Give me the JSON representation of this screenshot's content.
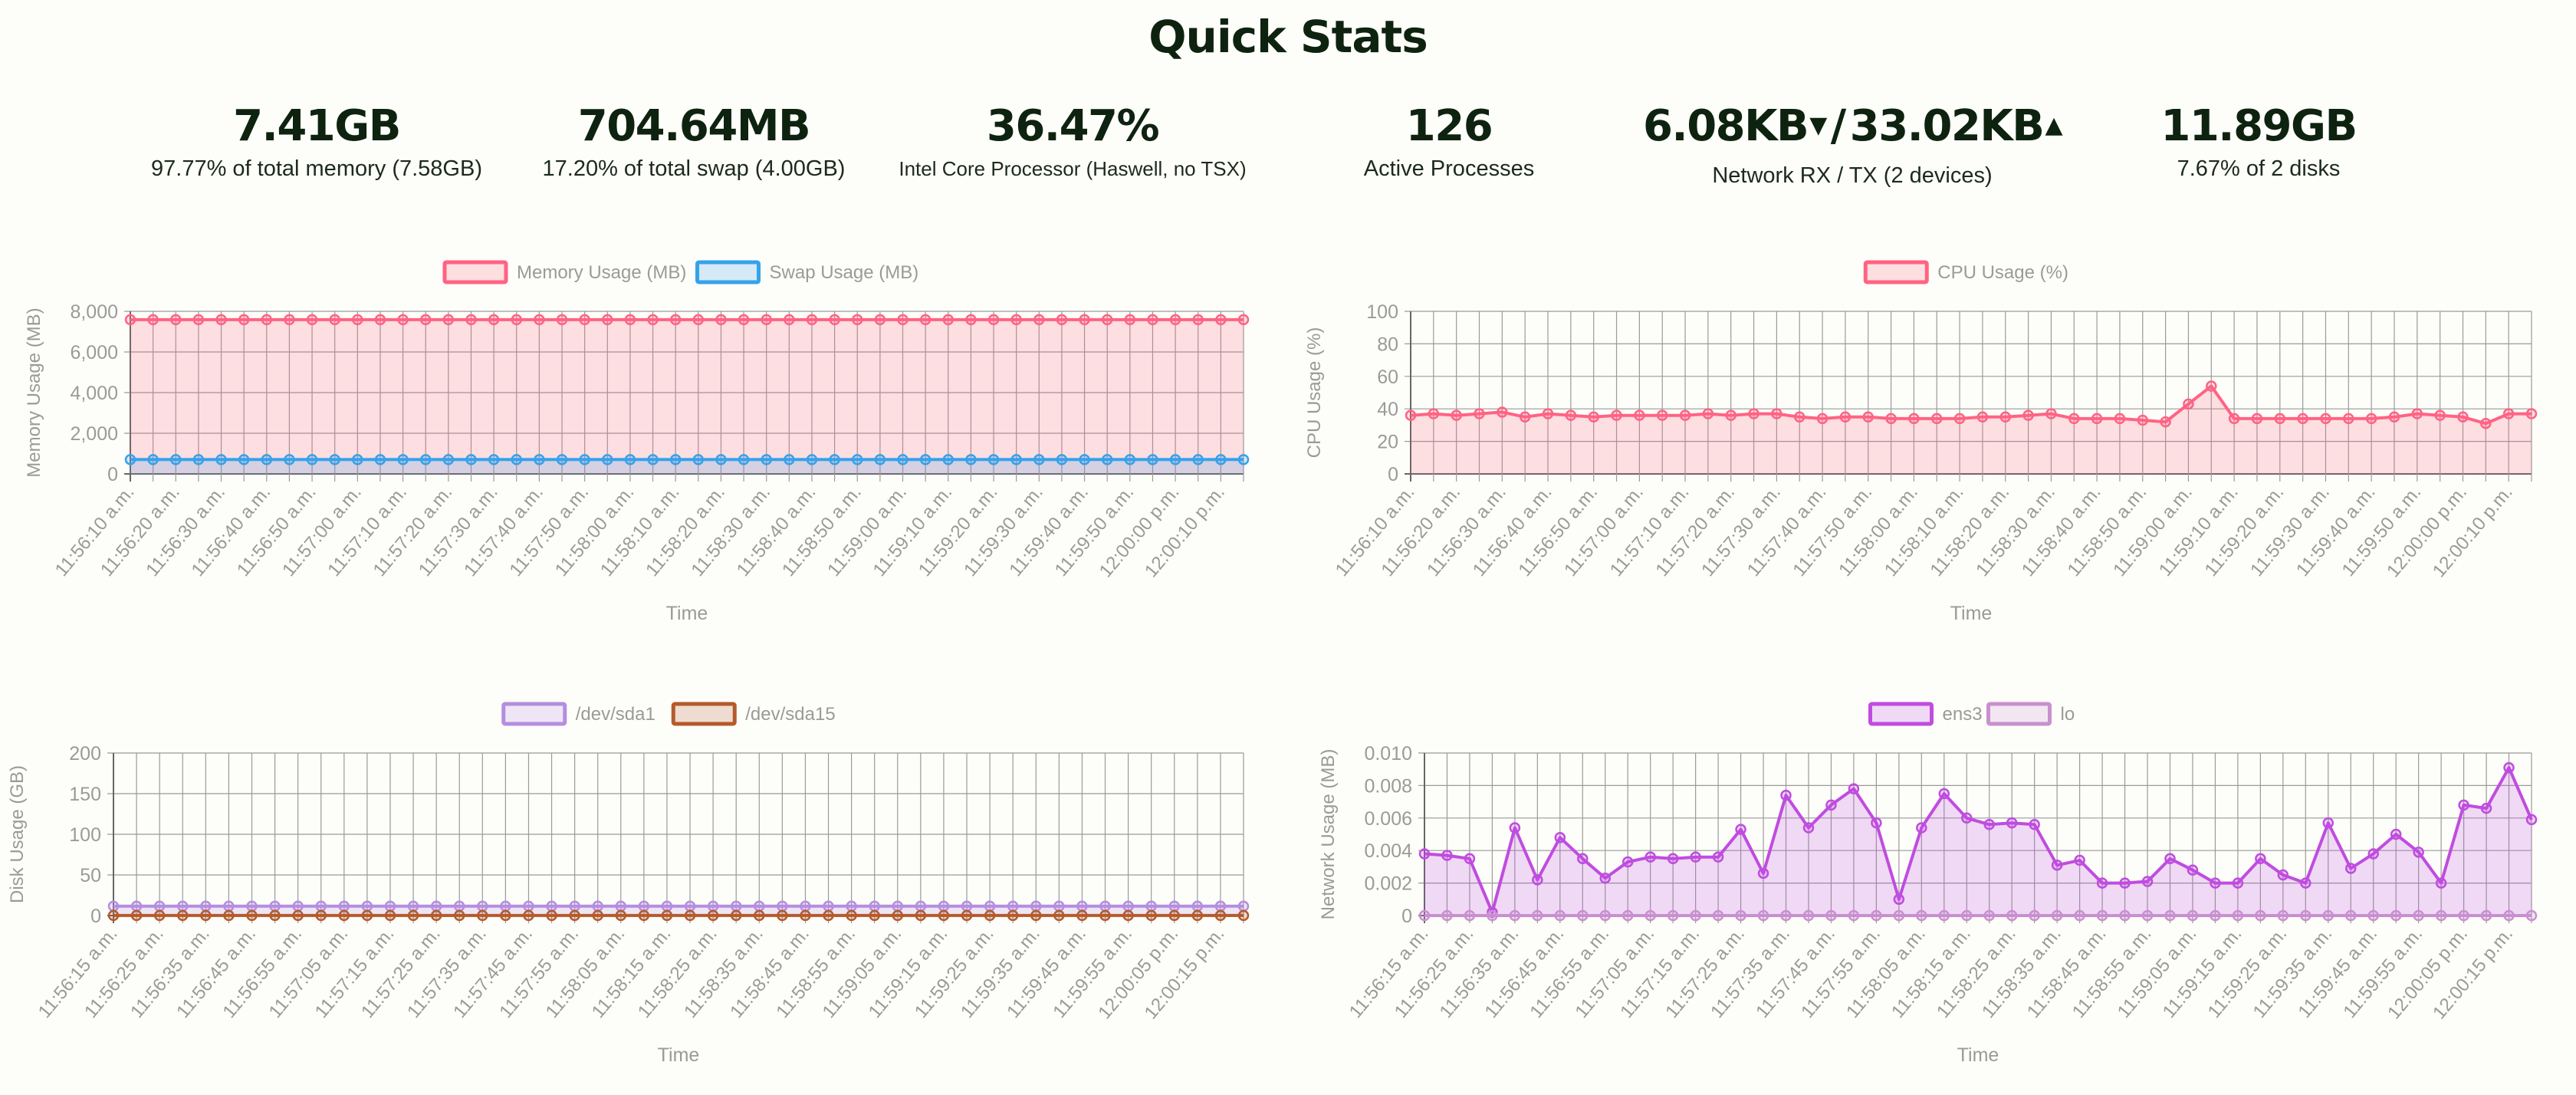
{
  "page": {
    "title": "Quick Stats"
  },
  "stats": [
    {
      "value": "7.41GB",
      "label": "97.77% of total memory (7.58GB)"
    },
    {
      "value": "704.64MB",
      "label": "17.20% of total swap (4.00GB)"
    },
    {
      "value": "36.47%",
      "label": "Intel Core Processor (Haswell, no TSX)"
    },
    {
      "value": "126",
      "label": "Active Processes"
    },
    {
      "value_rx": "6.08KB",
      "rx_icon": "arrow-down-icon",
      "slash": "/",
      "value_tx": "33.02KB",
      "tx_icon": "arrow-up-icon",
      "label": "Network RX / TX (2 devices)"
    },
    {
      "value": "11.89GB",
      "label": "7.67% of 2 disks"
    }
  ],
  "chart_data": [
    {
      "type": "area",
      "xlabel": "Time",
      "ylabel": "Memory Usage (MB)",
      "ylim": [
        0,
        8000
      ],
      "yticks": [
        0,
        2000,
        4000,
        6000,
        8000
      ],
      "yticklabels": [
        "0",
        "2,000",
        "4,000",
        "6,000",
        "8,000"
      ],
      "legend_position": "top-center",
      "grid": true,
      "points_count": 50,
      "x_labels": [
        "11:56:10 a.m.",
        "11:56:20 a.m.",
        "11:56:30 a.m.",
        "11:56:40 a.m.",
        "11:56:50 a.m.",
        "11:57:00 a.m.",
        "11:57:10 a.m.",
        "11:57:20 a.m.",
        "11:57:30 a.m.",
        "11:57:40 a.m.",
        "11:57:50 a.m.",
        "11:58:00 a.m.",
        "11:58:10 a.m.",
        "11:58:20 a.m.",
        "11:58:30 a.m.",
        "11:58:40 a.m.",
        "11:58:50 a.m.",
        "11:59:00 a.m.",
        "11:59:10 a.m.",
        "11:59:20 a.m.",
        "11:59:30 a.m.",
        "11:59:40 a.m.",
        "11:59:50 a.m.",
        "12:00:00 p.m.",
        "12:00:10 p.m."
      ],
      "series": [
        {
          "name": "Memory Usage (MB)",
          "color": "#ff6384",
          "fill": "rgba(255,99,132,0.2)",
          "values": [
            7590,
            7590,
            7590,
            7590,
            7590,
            7590,
            7590,
            7590,
            7590,
            7590,
            7590,
            7590,
            7590,
            7590,
            7590,
            7590,
            7590,
            7590,
            7590,
            7590,
            7590,
            7590,
            7590,
            7590,
            7590,
            7590,
            7590,
            7590,
            7590,
            7590,
            7590,
            7590,
            7590,
            7590,
            7590,
            7590,
            7590,
            7590,
            7590,
            7590,
            7590,
            7590,
            7590,
            7590,
            7590,
            7590,
            7590,
            7590,
            7590,
            7590
          ]
        },
        {
          "name": "Swap Usage (MB)",
          "color": "#36a2eb",
          "fill": "rgba(54,162,235,0.2)",
          "values": [
            705,
            705,
            705,
            705,
            705,
            705,
            705,
            705,
            705,
            705,
            705,
            705,
            705,
            705,
            705,
            705,
            705,
            705,
            705,
            705,
            705,
            705,
            705,
            705,
            705,
            705,
            705,
            705,
            705,
            705,
            705,
            705,
            705,
            705,
            705,
            705,
            705,
            705,
            705,
            705,
            705,
            705,
            705,
            705,
            705,
            705,
            705,
            705,
            705,
            705
          ]
        }
      ]
    },
    {
      "type": "area",
      "xlabel": "Time",
      "ylabel": "CPU Usage (%)",
      "ylim": [
        0,
        100
      ],
      "yticks": [
        0,
        20,
        40,
        60,
        80,
        100
      ],
      "yticklabels": [
        "0",
        "20",
        "40",
        "60",
        "80",
        "100"
      ],
      "legend_position": "top-center",
      "grid": true,
      "points_count": 50,
      "x_labels": [
        "11:56:10 a.m.",
        "11:56:20 a.m.",
        "11:56:30 a.m.",
        "11:56:40 a.m.",
        "11:56:50 a.m.",
        "11:57:00 a.m.",
        "11:57:10 a.m.",
        "11:57:20 a.m.",
        "11:57:30 a.m.",
        "11:57:40 a.m.",
        "11:57:50 a.m.",
        "11:58:00 a.m.",
        "11:58:10 a.m.",
        "11:58:20 a.m.",
        "11:58:30 a.m.",
        "11:58:40 a.m.",
        "11:58:50 a.m.",
        "11:59:00 a.m.",
        "11:59:10 a.m.",
        "11:59:20 a.m.",
        "11:59:30 a.m.",
        "11:59:40 a.m.",
        "11:59:50 a.m.",
        "12:00:00 p.m.",
        "12:00:10 p.m."
      ],
      "series": [
        {
          "name": "CPU Usage (%)",
          "color": "#ff6384",
          "fill": "rgba(255,99,132,0.2)",
          "values": [
            36,
            37,
            36,
            37,
            38,
            35,
            37,
            36,
            35,
            36,
            36,
            36,
            36,
            37,
            36,
            37,
            37,
            35,
            34,
            35,
            35,
            34,
            34,
            34,
            34,
            35,
            35,
            36,
            37,
            34,
            34,
            34,
            33,
            32,
            43,
            54,
            34,
            34,
            34,
            34,
            34,
            34,
            34,
            35,
            37,
            36,
            35,
            31,
            37,
            37
          ]
        }
      ]
    },
    {
      "type": "area",
      "xlabel": "Time",
      "ylabel": "Disk Usage (GB)",
      "ylim": [
        0,
        200
      ],
      "yticks": [
        0,
        50,
        100,
        150,
        200
      ],
      "yticklabels": [
        "0",
        "50",
        "100",
        "150",
        "200"
      ],
      "legend_position": "top-center",
      "grid": true,
      "points_count": 50,
      "x_labels": [
        "11:56:15 a.m.",
        "11:56:25 a.m.",
        "11:56:35 a.m.",
        "11:56:45 a.m.",
        "11:56:55 a.m.",
        "11:57:05 a.m.",
        "11:57:15 a.m.",
        "11:57:25 a.m.",
        "11:57:35 a.m.",
        "11:57:45 a.m.",
        "11:57:55 a.m.",
        "11:58:05 a.m.",
        "11:58:15 a.m.",
        "11:58:25 a.m.",
        "11:58:35 a.m.",
        "11:58:45 a.m.",
        "11:58:55 a.m.",
        "11:59:05 a.m.",
        "11:59:15 a.m.",
        "11:59:25 a.m.",
        "11:59:35 a.m.",
        "11:59:45 a.m.",
        "11:59:55 a.m.",
        "12:00:05 p.m.",
        "12:00:15 p.m."
      ],
      "series": [
        {
          "name": "/dev/sda1",
          "color": "#b48ee0",
          "fill": "rgba(180,142,224,0.2)",
          "values": [
            11.5,
            11.5,
            11.5,
            11.5,
            11.5,
            11.5,
            11.5,
            11.5,
            11.5,
            11.5,
            11.5,
            11.5,
            11.5,
            11.5,
            11.5,
            11.5,
            11.5,
            11.5,
            11.5,
            11.5,
            11.5,
            11.5,
            11.5,
            11.5,
            11.5,
            11.5,
            11.5,
            11.5,
            11.5,
            11.5,
            11.5,
            11.5,
            11.5,
            11.5,
            11.5,
            11.5,
            11.5,
            11.5,
            11.5,
            11.5,
            11.5,
            11.5,
            11.5,
            11.5,
            11.5,
            11.5,
            11.5,
            11.5,
            11.5,
            11.5
          ]
        },
        {
          "name": "/dev/sda15",
          "color": "#b55a2c",
          "fill": "rgba(181,90,44,0.2)",
          "values": [
            0.1,
            0.1,
            0.1,
            0.1,
            0.1,
            0.1,
            0.1,
            0.1,
            0.1,
            0.1,
            0.1,
            0.1,
            0.1,
            0.1,
            0.1,
            0.1,
            0.1,
            0.1,
            0.1,
            0.1,
            0.1,
            0.1,
            0.1,
            0.1,
            0.1,
            0.1,
            0.1,
            0.1,
            0.1,
            0.1,
            0.1,
            0.1,
            0.1,
            0.1,
            0.1,
            0.1,
            0.1,
            0.1,
            0.1,
            0.1,
            0.1,
            0.1,
            0.1,
            0.1,
            0.1,
            0.1,
            0.1,
            0.1,
            0.1,
            0.1
          ]
        }
      ]
    },
    {
      "type": "area",
      "xlabel": "Time",
      "ylabel": "Network Usage (MB)",
      "ylim": [
        0,
        0.01
      ],
      "yticks": [
        0,
        0.002,
        0.004,
        0.006,
        0.008,
        0.01
      ],
      "yticklabels": [
        "0",
        "0.002",
        "0.004",
        "0.006",
        "0.008",
        "0.010"
      ],
      "legend_position": "top-center",
      "grid": true,
      "points_count": 50,
      "x_labels": [
        "11:56:15 a.m.",
        "11:56:25 a.m.",
        "11:56:35 a.m.",
        "11:56:45 a.m.",
        "11:56:55 a.m.",
        "11:57:05 a.m.",
        "11:57:15 a.m.",
        "11:57:25 a.m.",
        "11:57:35 a.m.",
        "11:57:45 a.m.",
        "11:57:55 a.m.",
        "11:58:05 a.m.",
        "11:58:15 a.m.",
        "11:58:25 a.m.",
        "11:58:35 a.m.",
        "11:58:45 a.m.",
        "11:58:55 a.m.",
        "11:59:05 a.m.",
        "11:59:15 a.m.",
        "11:59:25 a.m.",
        "11:59:35 a.m.",
        "11:59:45 a.m.",
        "11:59:55 a.m.",
        "12:00:05 p.m.",
        "12:00:15 p.m."
      ],
      "series": [
        {
          "name": "ens3",
          "color": "#c04ce0",
          "fill": "rgba(192,76,224,0.2)",
          "values": [
            0.0038,
            0.0037,
            0.0035,
            0.0002,
            0.0054,
            0.0022,
            0.0048,
            0.0035,
            0.0023,
            0.0033,
            0.0036,
            0.0035,
            0.0036,
            0.0036,
            0.0053,
            0.0026,
            0.0074,
            0.0054,
            0.0068,
            0.0078,
            0.0057,
            0.001,
            0.0054,
            0.0075,
            0.006,
            0.0056,
            0.0057,
            0.0056,
            0.0031,
            0.0034,
            0.002,
            0.002,
            0.0021,
            0.0035,
            0.0028,
            0.002,
            0.002,
            0.0035,
            0.0025,
            0.002,
            0.0057,
            0.0029,
            0.0038,
            0.005,
            0.0039,
            0.002,
            0.0068,
            0.0066,
            0.0091,
            0.0059
          ]
        },
        {
          "name": "lo",
          "color": "#c98fd0",
          "fill": "rgba(201,143,208,0.2)",
          "values": [
            0,
            0,
            0,
            0,
            0,
            0,
            0,
            0,
            0,
            0,
            0,
            0,
            0,
            0,
            0,
            0,
            0,
            0,
            0,
            0,
            0,
            0,
            0,
            0,
            0,
            0,
            0,
            0,
            0,
            0,
            0,
            0,
            0,
            0,
            0,
            0,
            0,
            0,
            0,
            0,
            0,
            0,
            0,
            0,
            0,
            0,
            0,
            0,
            0,
            0
          ]
        }
      ]
    }
  ]
}
